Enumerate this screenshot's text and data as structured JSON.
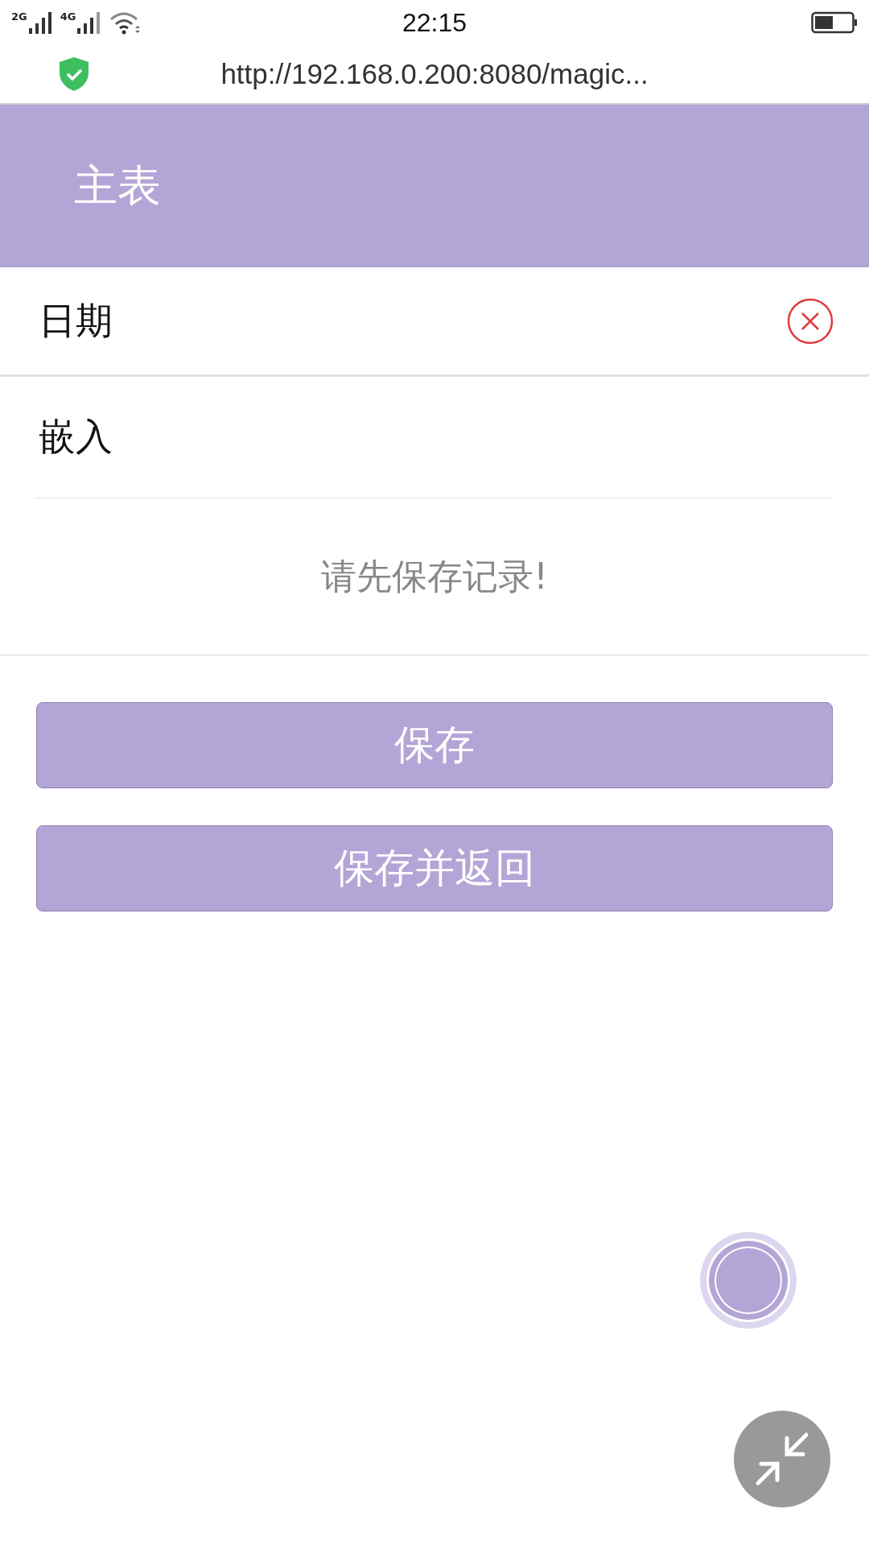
{
  "status_bar": {
    "signals": [
      {
        "label": "2G"
      },
      {
        "label": "4G"
      }
    ],
    "time": "22:15"
  },
  "url_bar": {
    "url": "http://192.168.0.200:8080/magic..."
  },
  "header": {
    "title": "主表"
  },
  "fields": [
    {
      "kind": "date",
      "label": "日期"
    },
    {
      "kind": "embed",
      "label": "嵌入",
      "message": "请先保存记录!"
    }
  ],
  "buttons": [
    {
      "label": "保存"
    },
    {
      "label": "保存并返回"
    }
  ]
}
